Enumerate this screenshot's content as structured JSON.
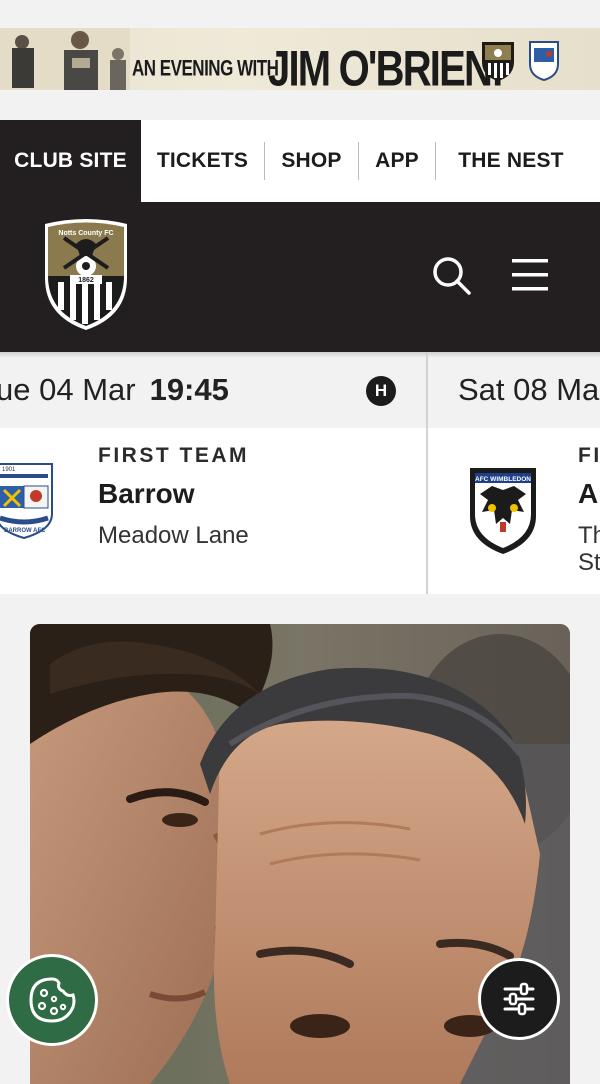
{
  "banner": {
    "promo_prefix": "AN EVENING WITH",
    "promo_name": "JIM O'BRIEN!"
  },
  "topnav": {
    "items": [
      {
        "label": "CLUB SITE",
        "active": true
      },
      {
        "label": "TICKETS",
        "active": false
      },
      {
        "label": "SHOP",
        "active": false
      },
      {
        "label": "APP",
        "active": false
      },
      {
        "label": "THE NEST",
        "active": false
      }
    ]
  },
  "header": {
    "crest_text": "Notts County FC",
    "crest_year": "1862",
    "icons": [
      "search-icon",
      "menu-icon"
    ]
  },
  "fixtures": [
    {
      "date": "ue 04 Mar",
      "time": "19:45",
      "home_away": "H",
      "team": "FIRST TEAM",
      "opponent": "Barrow",
      "venue": "Meadow Lane",
      "crest_text": "BARROW AFC",
      "crest_year": "1901"
    },
    {
      "date": "Sat 08 Ma",
      "time": "",
      "home_away": "",
      "team": "FI",
      "opponent": "A",
      "venue_line1": "Th",
      "venue_line2": "St",
      "crest_text": "AFC WIMBLEDON"
    }
  ],
  "floating": {
    "cookie_icon": "cookie-icon",
    "settings_icon": "sliders-icon"
  },
  "colors": {
    "dark": "#231f20",
    "gold": "#8a7a4e",
    "cookie_green": "#2f6b45"
  }
}
